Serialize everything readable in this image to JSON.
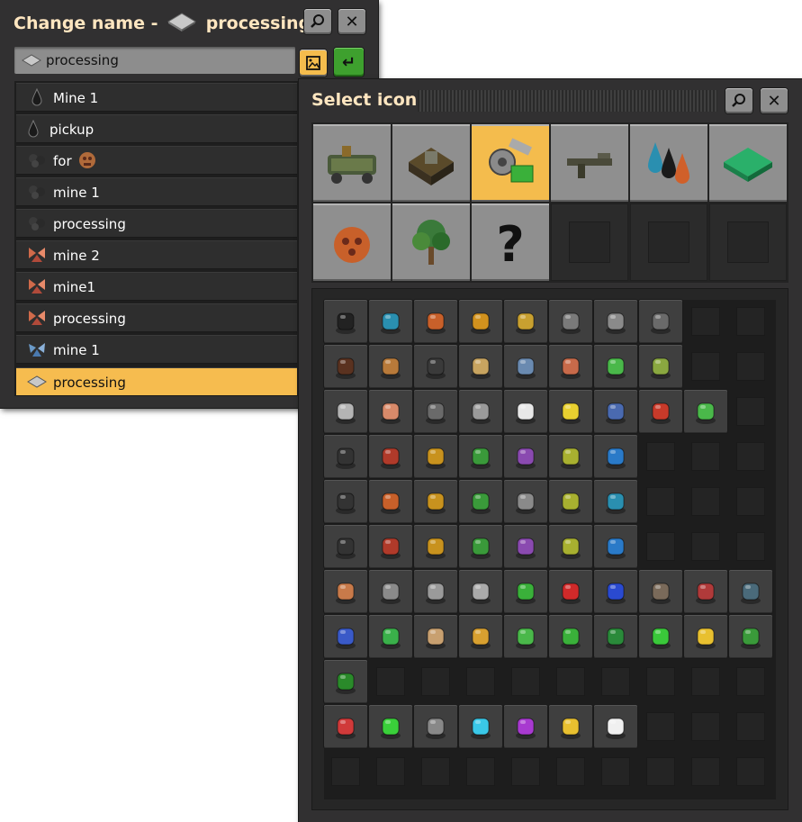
{
  "change_name": {
    "title_prefix": "Change name -",
    "title_name": "processing",
    "search_value": "processing",
    "rows": [
      {
        "label": "Mine 1",
        "icon": "crude-oil-icon"
      },
      {
        "label": "pickup",
        "icon": "crude-oil-icon"
      },
      {
        "label": "for",
        "icon": "coal-icon"
      },
      {
        "label": "mine 1",
        "icon": "coal-icon"
      },
      {
        "label": "processing",
        "icon": "coal-icon"
      },
      {
        "label": "mine 2",
        "icon": "copper-ore-icon"
      },
      {
        "label": "mine1",
        "icon": "copper-ore-icon"
      },
      {
        "label": "processing",
        "icon": "copper-ore-icon"
      },
      {
        "label": "mine 1",
        "icon": "iron-ore-icon"
      },
      {
        "label": "processing",
        "icon": "iron-plate-icon",
        "selected": true
      }
    ]
  },
  "select_icon": {
    "title": "Select icon",
    "tabs": [
      {
        "icon": "logistics-icon",
        "selected": false
      },
      {
        "icon": "production-icon",
        "selected": false
      },
      {
        "icon": "intermediate-products-icon",
        "selected": true
      },
      {
        "icon": "combat-icon",
        "selected": false
      },
      {
        "icon": "fluids-icon",
        "selected": false
      },
      {
        "icon": "tiles-icon",
        "selected": false
      },
      {
        "icon": "enemies-icon",
        "selected": false
      },
      {
        "icon": "environment-icon",
        "selected": false
      },
      {
        "icon": "unsorted-icon",
        "selected": false
      },
      {
        "icon": "",
        "selected": false
      },
      {
        "icon": "",
        "selected": false
      },
      {
        "icon": "",
        "selected": false
      }
    ],
    "grid": [
      [
        "#222222",
        "#2a8fb0",
        "#c8602a",
        "#d2921e",
        "#c8a030",
        "#7a7a7a",
        "#8a8a8a",
        "#6a6a6a",
        "",
        ""
      ],
      [
        "#5a3220",
        "#b87a3a",
        "#3a3a3a",
        "#c8a460",
        "#6a8ab0",
        "#c86a4a",
        "#4ab84a",
        "#8aa840",
        "",
        ""
      ],
      [
        "#b4b4b4",
        "#d88a6a",
        "#6a6a6a",
        "#9a9a9a",
        "#e8e8e8",
        "#e8d030",
        "#4a6ab0",
        "#c83a2a",
        "#4ab84a",
        ""
      ],
      [
        "#333333",
        "#b03a2a",
        "#c8921e",
        "#3a9a3a",
        "#8a4ab0",
        "#a8b030",
        "#2a7ac8",
        "",
        "",
        ""
      ],
      [
        "#333333",
        "#c8602a",
        "#c8921e",
        "#3a9a3a",
        "#8a8a8a",
        "#a8b030",
        "#2a8fb0",
        "",
        "",
        ""
      ],
      [
        "#333333",
        "#b03a2a",
        "#c8921e",
        "#3a9a3a",
        "#8a4ab0",
        "#a8b030",
        "#2a7ac8",
        "",
        "",
        ""
      ],
      [
        "#c87a4a",
        "#8a8a8a",
        "#9a9a9a",
        "#aaaaaa",
        "#3ab03a",
        "#d02a2a",
        "#2a4ad0",
        "#7a6a5a",
        "#b03a3a",
        "#4a6a7a"
      ],
      [
        "#3a5ac8",
        "#3ab04a",
        "#c8a070",
        "#d8a030",
        "#4ab84a",
        "#3ab03a",
        "#2a8a3a",
        "#3ac83a",
        "#e8c030",
        "#3a9a3a"
      ],
      [
        "#2a8a2a",
        "",
        "",
        "",
        "",
        "",
        "",
        "",
        "",
        ""
      ],
      [
        "#d03a3a",
        "#3ad03a",
        "#888888",
        "#3ac8e8",
        "#a83ad0",
        "#e8c030",
        "#f0f0f0",
        "",
        "",
        ""
      ],
      [
        "",
        "",
        "",
        "",
        "",
        "",
        "",
        "",
        "",
        ""
      ]
    ]
  }
}
